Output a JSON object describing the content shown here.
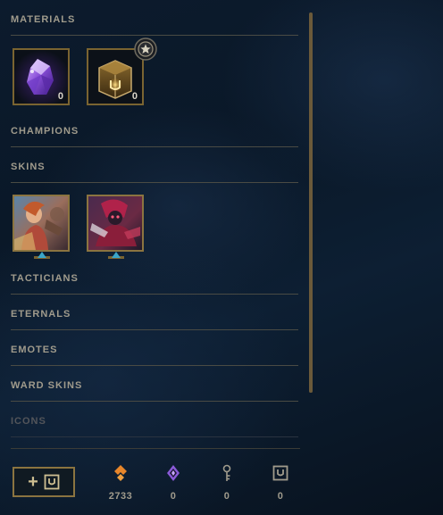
{
  "sections": {
    "materials": "MATERIALS",
    "champions": "CHAMPIONS",
    "skins": "SKINS",
    "tacticians": "TACTICIANS",
    "eternals": "ETERNALS",
    "emotes": "EMOTES",
    "ward_skins": "WARD SKINS",
    "icons": "ICONS"
  },
  "materials": [
    {
      "icon": "gemstone-icon",
      "count": "0"
    },
    {
      "icon": "chest-icon",
      "count": "0",
      "badge": "star-badge-icon"
    }
  ],
  "skins": [
    {
      "icon": "skin-art-1",
      "indicator": "blue-triangle-icon"
    },
    {
      "icon": "skin-art-2",
      "indicator": "blue-triangle-icon"
    }
  ],
  "footer": {
    "add_button_icon": "loot-key-icon",
    "currencies": [
      {
        "icon": "orange-essence-icon",
        "value": "2733",
        "color": "#e8862a"
      },
      {
        "icon": "mythic-essence-icon",
        "value": "0",
        "color": "#9a6ae0"
      },
      {
        "icon": "key-fragment-icon",
        "value": "0",
        "color": "#a09b8c"
      },
      {
        "icon": "loot-key-icon",
        "value": "0",
        "color": "#a09b8c"
      }
    ]
  },
  "colors": {
    "gold": "#c8aa6e",
    "header_text": "#a09b8c",
    "accent_blue": "#3aa6c8"
  }
}
